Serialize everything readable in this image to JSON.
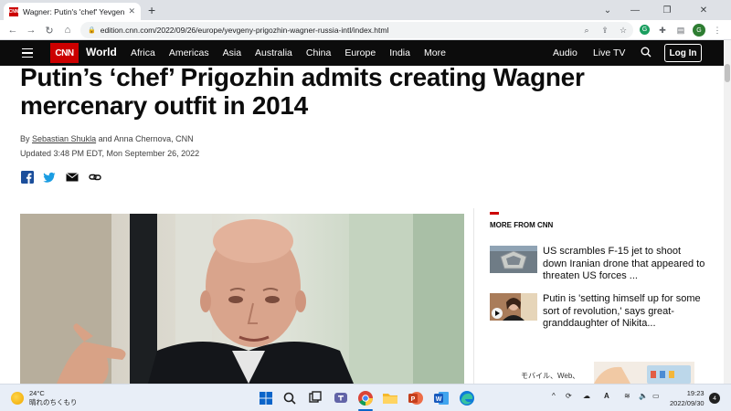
{
  "browser": {
    "tab_title": "Wagner: Putin's 'chef' Yevgeny Pr",
    "tab_favicon": "CNN",
    "url": "edition.cnn.com/2022/09/26/europe/yevgeny-prigozhin-wagner-russia-intl/index.html",
    "profile_initial": "G"
  },
  "nav": {
    "logo": "CNN",
    "section": "World",
    "links": [
      "Africa",
      "Americas",
      "Asia",
      "Australia",
      "China",
      "Europe",
      "India",
      "More"
    ],
    "audio": "Audio",
    "live_tv": "Live TV",
    "login": "Log In"
  },
  "article": {
    "headline": "Putin’s ‘chef’ Prigozhin admits creating Wagner mercenary outfit in 2014",
    "by_prefix": "By",
    "author1": "Sebastian Shukla",
    "author_rest": "and Anna Chernova, CNN",
    "updated": "Updated 3:48 PM EDT, Mon September 26, 2022"
  },
  "sidebar": {
    "label": "MORE FROM CNN",
    "stories": [
      {
        "text": "US scrambles F-15 jet to shoot down Iranian drone that appeared to threaten US forces ..."
      },
      {
        "text": "Putin is 'setting himself up for some sort of revolution,' says great-granddaughter of Nikita..."
      }
    ],
    "ad_text": "モバイル、Web、"
  },
  "taskbar": {
    "temp": "24°C",
    "weather": "晴れのちくもり",
    "time": "19:23",
    "date": "2022/09/30",
    "notifications": "4",
    "ime": "A"
  },
  "colors": {
    "cnn_red": "#cc0000",
    "nav_bg": "#0c0c0c"
  }
}
